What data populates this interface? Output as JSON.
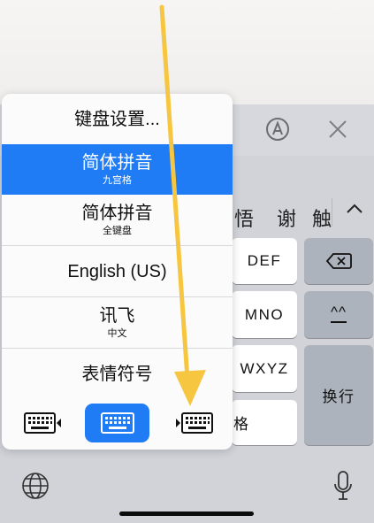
{
  "toolbar": {
    "compose_icon": "a-circle-icon",
    "close_icon": "close-icon"
  },
  "candidates": {
    "items": [
      "悟",
      "谢",
      "触"
    ],
    "expand_icon": "chevron-up-icon"
  },
  "keys": {
    "def": "DEF",
    "mno": "MNO",
    "wxyz": "WXYZ",
    "ge": "格",
    "smiley": "^^",
    "enter": "换行",
    "delete_icon": "delete-icon"
  },
  "menu": {
    "settings": "键盘设置...",
    "pinyin_9": {
      "label": "简体拼音",
      "sub": "九宫格"
    },
    "pinyin_full": {
      "label": "简体拼音",
      "sub": "全键盘"
    },
    "english": "English (US)",
    "xunfei": {
      "label": "讯飞",
      "sub": "中文"
    },
    "emoji": "表情符号",
    "layout_icons": [
      "keyboard-left-icon",
      "keyboard-full-icon",
      "keyboard-right-icon"
    ],
    "selected_color": "#1f7cf5"
  },
  "bottom": {
    "globe_icon": "globe-icon",
    "mic_icon": "microphone-icon"
  },
  "annotation": {
    "color": "#f6c640",
    "icon": "arrow-icon"
  }
}
